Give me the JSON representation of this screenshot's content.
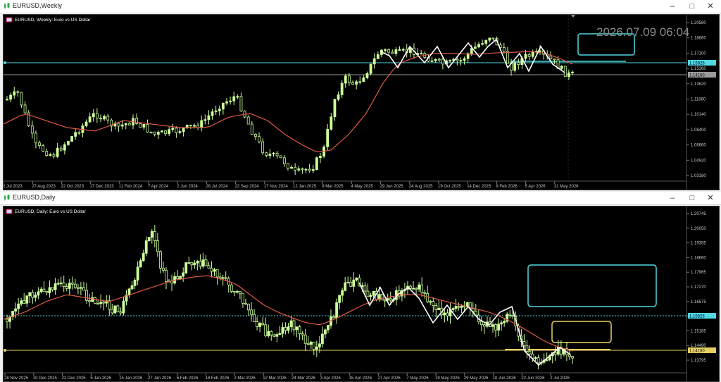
{
  "weekly": {
    "window_title": "EURUSD,Weekly",
    "chart_label": "EURUSD, Weekly:  Euro vs US Dollar",
    "clock": "2026.07.09 06:04",
    "price_ticks": [
      "1.20580",
      "1.18860",
      "1.17100",
      "1.15360",
      "1.13620",
      "1.11880",
      "1.10140",
      "1.08400",
      "1.06660",
      "1.04920",
      "1.03180"
    ],
    "cyan_badge": "1.15925",
    "gray_badge": "1.14160",
    "time_ticks": [
      "2 Jul 2023",
      "27 Aug 2023",
      "22 Oct 2023",
      "17 Dec 2023",
      "11 Feb 2024",
      "7 Apr 2024",
      "2 Jun 2024",
      "28 Jul 2024",
      "22 Sep 2024",
      "17 Nov 2024",
      "12 Jan 2025",
      "9 Mar 2025",
      "4 May 2025",
      "29 Jun 2025",
      "24 Aug 2025",
      "19 Oct 2025",
      "14 Dec 2025",
      "8 Feb 2026",
      "5 Apr 2026",
      "31 May 2026"
    ]
  },
  "daily": {
    "window_title": "EURUSD,Daily",
    "chart_label": "EURUSD, Daily:  Euro vs US Dollar",
    "price_ticks": [
      "1.20745",
      "1.20050",
      "1.19355",
      "1.18660",
      "1.17965",
      "1.17270",
      "1.16575",
      "1.15880",
      "1.15185",
      "1.14490",
      "1.13795"
    ],
    "cyan_badge": "1.15925",
    "yellow_badge": "1.14160",
    "time_ticks": [
      "28 Nov 2025",
      "10 Dec 2025",
      "22 Dec 2025",
      "5 Jan 2026",
      "15 Jan 2026",
      "27 Jan 2026",
      "6 Feb 2026",
      "18 Feb 2026",
      "2 Mar 2026",
      "12 Mar 2026",
      "24 Mar 2026",
      "3 Apr 2026",
      "15 Apr 2026",
      "27 Apr 2026",
      "7 May 2026",
      "19 May 2026",
      "29 May 2026",
      "10 Jun 2026",
      "22 Jun 2026",
      "2 Jul 2026"
    ]
  },
  "colors": {
    "candle": "#ccff99",
    "ma": "#e05a46",
    "zigzag": "#ffffff",
    "cyan": "#4fd8e0",
    "yellow": "#e8d060",
    "grid_gray": "#9a9a9a"
  },
  "icons": [
    "chart-window-icon",
    "minimize-icon",
    "maximize-icon",
    "close-icon"
  ]
}
